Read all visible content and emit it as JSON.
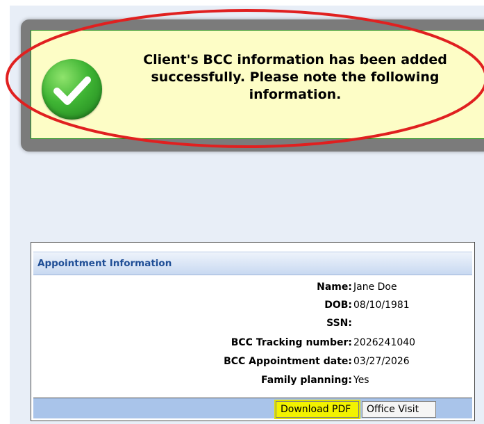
{
  "message": {
    "text": "Client's BCC information has been added successfully. Please note the following information.",
    "icon": "checkmark-success-icon",
    "colors": {
      "panel_bg": "#fdfdc6",
      "panel_border": "#1f8c1f",
      "highlight_ring": "#e02020",
      "icon_green": "#3fb534"
    }
  },
  "appointment": {
    "header": "Appointment Information",
    "rows": [
      {
        "label": "Name:",
        "value": "Jane Doe"
      },
      {
        "label": "DOB:",
        "value": "08/10/1981"
      },
      {
        "label": "SSN:",
        "value": ""
      },
      {
        "label": "BCC Tracking number:",
        "value": "2026241040"
      },
      {
        "label": "BCC Appointment date:",
        "value": "03/27/2026"
      },
      {
        "label": "Family planning:",
        "value": "Yes"
      }
    ]
  },
  "buttons": {
    "download_pdf": "Download PDF",
    "office_visit": "Office Visit"
  }
}
